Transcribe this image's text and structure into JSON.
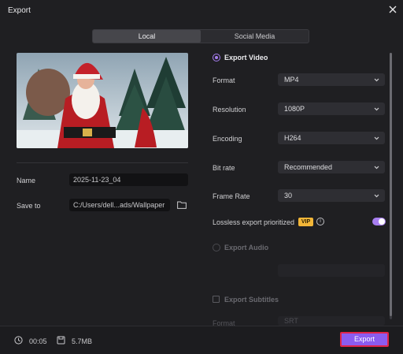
{
  "window": {
    "title": "Export",
    "close_icon": "close-icon"
  },
  "tabs": [
    {
      "label": "Local",
      "active": true
    },
    {
      "label": "Social Media",
      "active": false
    }
  ],
  "left": {
    "name_label": "Name",
    "name_value": "2025-11-23_04",
    "save_label": "Save to",
    "save_value": "C:/Users/dell...ads/Wallpaper",
    "folder_icon": "folder-icon"
  },
  "video": {
    "section": "Export Video",
    "format_label": "Format",
    "format_value": "MP4",
    "resolution_label": "Resolution",
    "resolution_value": "1080P",
    "encoding_label": "Encoding",
    "encoding_value": "H264",
    "bitrate_label": "Bit rate",
    "bitrate_value": "Recommended",
    "framerate_label": "Frame Rate",
    "framerate_value": "30",
    "lossless_label": "Lossless export prioritized",
    "vip_badge": "VIP",
    "info_icon": "info-icon",
    "lossless_on": true
  },
  "audio": {
    "section": "Export Audio"
  },
  "subtitles": {
    "section": "Export Subtitles",
    "format_label": "Format",
    "format_value": "SRT"
  },
  "footer": {
    "duration": "00:05",
    "size": "5.7MB",
    "export_label": "Export"
  },
  "colors": {
    "accent": "#8b5cf0",
    "highlight": "#e0254a",
    "vip": "#f2b638"
  }
}
